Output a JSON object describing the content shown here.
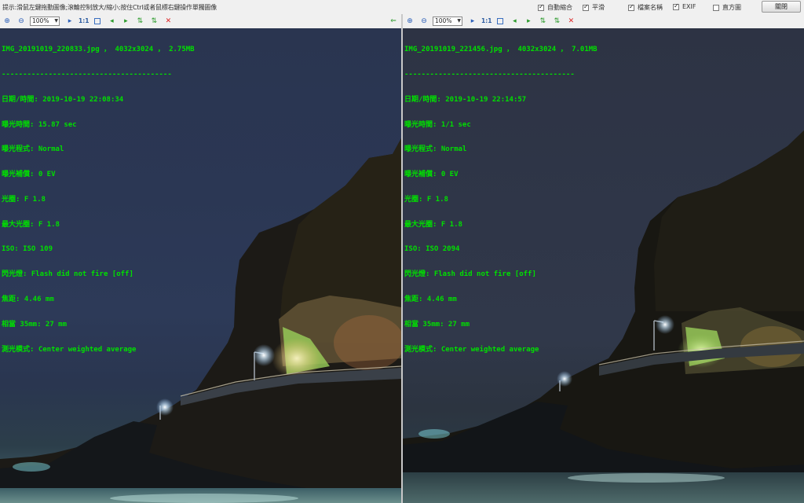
{
  "top": {
    "hint": "提示:滑鼠左鍵拖動圖像;滾輪控制放大/縮小;按住Ctrl或者鼠標右鍵操作單獨圖像",
    "options": [
      {
        "label": "自動縮合",
        "checked": true
      },
      {
        "label": "平滑",
        "checked": true
      },
      {
        "label": "檔案名稱",
        "checked": true
      },
      {
        "label": "EXIF",
        "checked": true
      },
      {
        "label": "直方圖",
        "checked": false
      }
    ],
    "close_label": "關閉"
  },
  "toolbar": {
    "zoom": "100%",
    "ratio": "1:1"
  },
  "icons": {
    "zoom_in": "⊕",
    "zoom_out": "⊖",
    "fit": "□",
    "prev": "◂",
    "next": "▸",
    "sync": "⇅",
    "close": "✕",
    "link": "⇐",
    "dropdown": "▼"
  },
  "left": {
    "filename": "IMG_20191019_220833.jpg ， 4032x3024 ， 2.75MB",
    "divider": "----------------------------------------",
    "exif": [
      "日期/時間: 2019-10-19 22:08:34",
      "曝光時間: 15.87 sec",
      "曝光程式: Normal",
      "曝光補償: 0 EV",
      "光圈: F 1.8",
      "最大光圈: F 1.8",
      "ISO: ISO 109",
      "閃光燈: Flash did not fire [off]",
      "焦距: 4.46 mm",
      "相當 35mm: 27 mm",
      "測光模式: Center weighted average"
    ]
  },
  "right": {
    "filename": "IMG_20191019_221456.jpg ， 4032x3024 ， 7.01MB",
    "divider": "----------------------------------------",
    "exif": [
      "日期/時間: 2019-10-19 22:14:57",
      "曝光時間: 1/1 sec",
      "曝光程式: Normal",
      "曝光補償: 0 EV",
      "光圈: F 1.8",
      "最大光圈: F 1.8",
      "ISO: ISO 2094",
      "閃光燈: Flash did not fire [off]",
      "焦距: 4.46 mm",
      "相當 35mm: 27 mm",
      "測光模式: Center weighted average"
    ]
  },
  "colors": {
    "exif_text": "#00e000",
    "cliff_dark": "#1c1a16",
    "cliff_lit": "#6a5a3a",
    "lamp_glow": "#e8f6ff",
    "foliage": "#9ad05a"
  }
}
